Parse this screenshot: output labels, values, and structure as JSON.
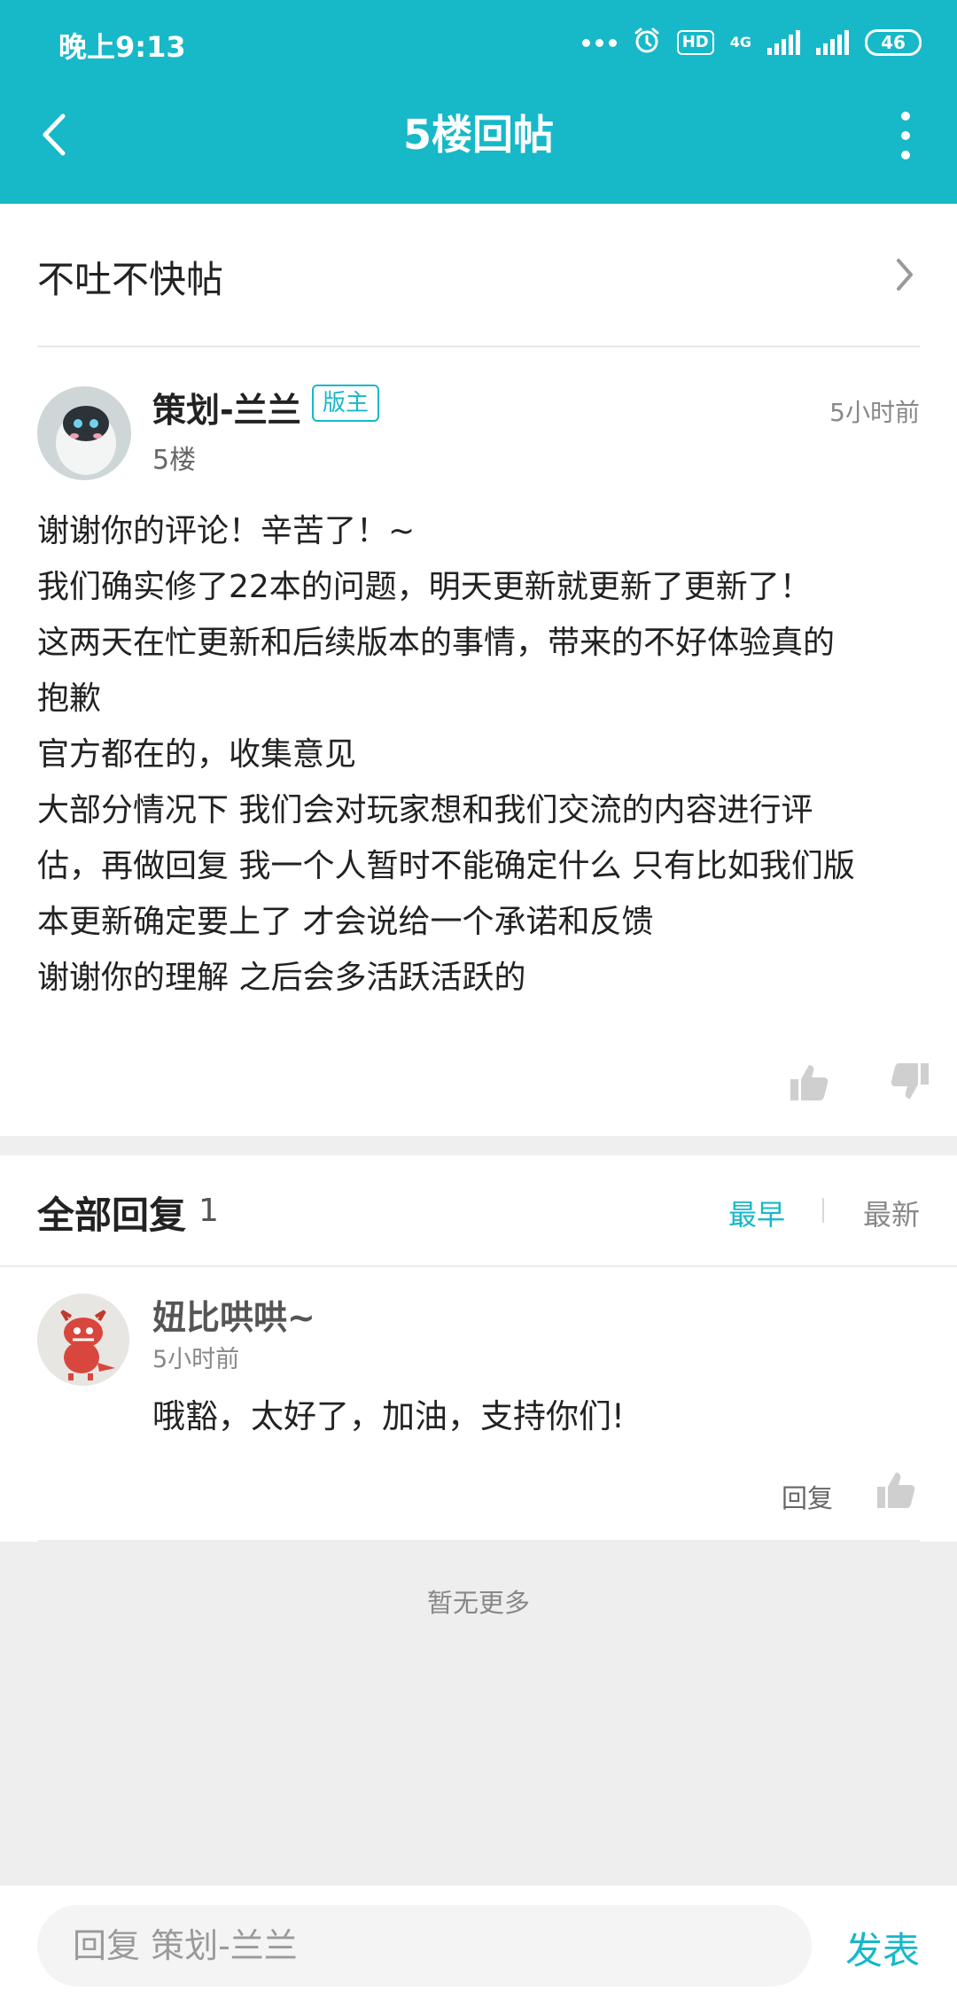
{
  "status": {
    "time": "晚上9:13",
    "network": "4G",
    "hd": "HD",
    "battery": "46"
  },
  "header": {
    "title": "5楼回帖"
  },
  "board": {
    "label": "不吐不快帖"
  },
  "post": {
    "author": "策划-兰兰",
    "badge": "版主",
    "floor": "5楼",
    "time": "5小时前",
    "content": "谢谢你的评论！辛苦了！~\n我们确实修了22本的问题，明天更新就更新了更新了！\n这两天在忙更新和后续版本的事情，带来的不好体验真的\n抱歉\n官方都在的，收集意见\n大部分情况下 我们会对玩家想和我们交流的内容进行评\n估，再做回复 我一个人暂时不能确定什么 只有比如我们版\n本更新确定要上了 才会说给一个承诺和反馈\n谢谢你的理解 之后会多活跃活跃的"
  },
  "replies": {
    "title": "全部回复",
    "count": "1",
    "sort_earliest": "最早",
    "sort_latest": "最新",
    "items": [
      {
        "name": "妞比哄哄~",
        "time": "5小时前",
        "text": "哦豁，太好了，加油，支持你们!",
        "reply_label": "回复"
      }
    ],
    "no_more": "暂无更多"
  },
  "composer": {
    "placeholder": "回复 策划-兰兰",
    "send_label": "发表"
  },
  "colors": {
    "accent": "#17b8c8"
  }
}
